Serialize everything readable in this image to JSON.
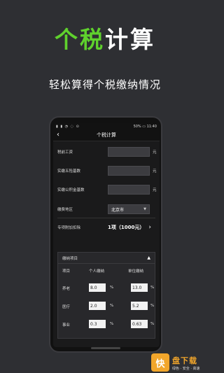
{
  "hero": {
    "title_green": "个税",
    "title_white": "计算",
    "subtitle": "轻松算得个税缴纳情况"
  },
  "status": {
    "left": "▮ ▮ ◔ ◌ ⊙",
    "right": "50% ▭ 11:40"
  },
  "nav": {
    "back": "‹",
    "title": "个税计算"
  },
  "fields": [
    {
      "label": "税前工资",
      "unit": "元"
    },
    {
      "label": "实缴五险基数",
      "unit": "元"
    },
    {
      "label": "实缴公积金基数",
      "unit": "元"
    }
  ],
  "region": {
    "label": "缴费地区",
    "value": "北京市",
    "caret": "▼"
  },
  "special": {
    "label": "专项附加扣除",
    "value": "1项（1000元）",
    "chevron": "›"
  },
  "panel": {
    "title": "缴纳项目",
    "toggle": "▲",
    "headers": {
      "item": "项目",
      "personal": "个人缴纳",
      "company": "单位缴纳"
    },
    "rows": [
      {
        "name": "养老",
        "personal": "8.0",
        "company": "13.0",
        "pct": "%"
      },
      {
        "name": "医疗",
        "personal": "2.0",
        "company": "5.2",
        "pct": "%"
      },
      {
        "name": "事业",
        "personal": "0.3",
        "company": "0.63",
        "pct": "%"
      }
    ]
  },
  "badge": {
    "logo": "快",
    "name": "盘下载",
    "tagline": "绿色 · 安全 · 高速"
  }
}
